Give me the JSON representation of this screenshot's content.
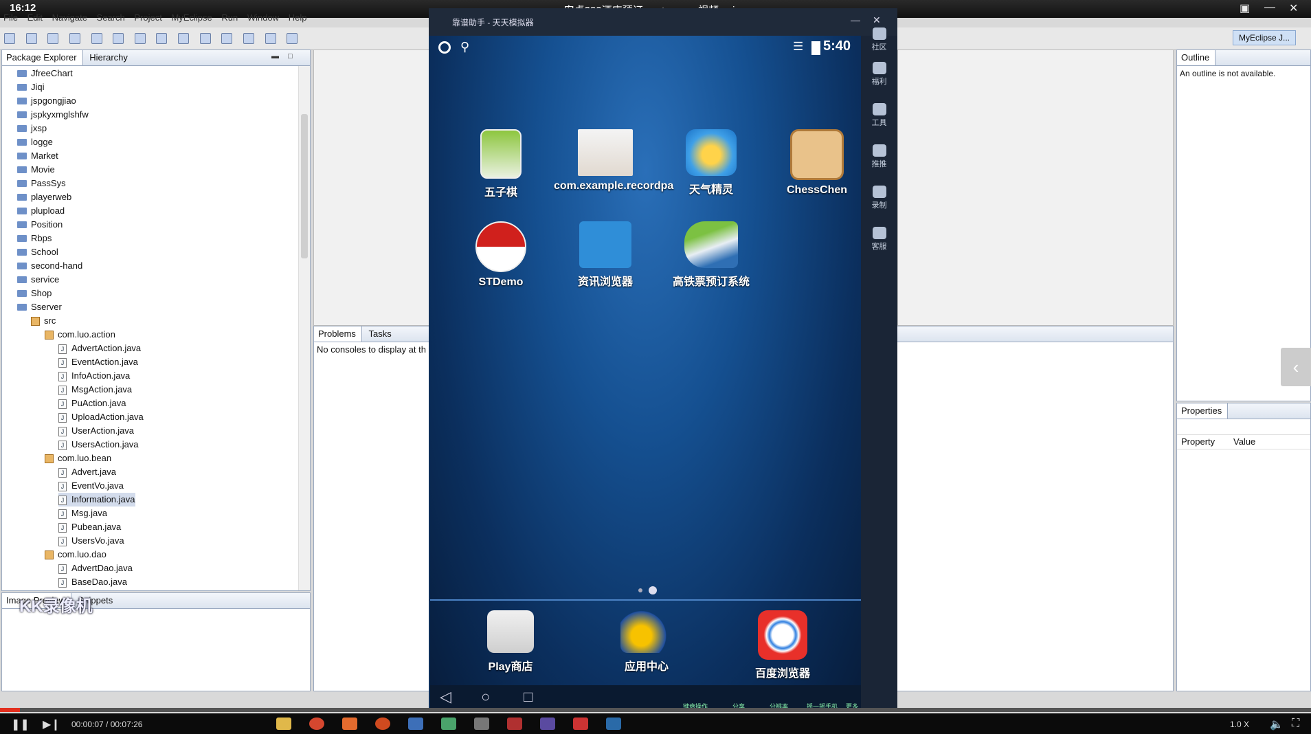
{
  "player": {
    "clock": "16:12",
    "title": "安卓382酒店预订app+server-视频.avi",
    "time_display": "00:00:07 / 00:07:26",
    "speed": "1.0 X",
    "progress": 0.015
  },
  "menu": [
    "File",
    "Edit",
    "Navigate",
    "Search",
    "Project",
    "MyEclipse",
    "Run",
    "Window",
    "Help"
  ],
  "perspective": "MyEclipse J...",
  "package_explorer": {
    "tabs": [
      "Package Explorer",
      "Hierarchy"
    ],
    "projects": [
      "JfreeChart",
      "Jiqi",
      "jspgongjiao",
      "jspkyxmglshfw",
      "jxsp",
      "logge",
      "Market",
      "Movie",
      "PassSys",
      "playerweb",
      "plupload",
      "Position",
      "Rbps",
      "School",
      "second-hand",
      "service",
      "Shop",
      "Sserver"
    ],
    "src": "src",
    "packages": [
      {
        "name": "com.luo.action",
        "files": [
          "AdvertAction.java",
          "EventAction.java",
          "InfoAction.java",
          "MsgAction.java",
          "PuAction.java",
          "UploadAction.java",
          "UserAction.java",
          "UsersAction.java"
        ]
      },
      {
        "name": "com.luo.bean",
        "files": [
          "Advert.java",
          "EventVo.java",
          "Information.java",
          "Msg.java",
          "Pubean.java",
          "UsersVo.java"
        ]
      },
      {
        "name": "com.luo.dao",
        "files": [
          "AdvertDao.java",
          "BaseDao.java"
        ]
      }
    ],
    "selected_file": "Information.java"
  },
  "bottom_left": {
    "tabs": [
      "Image Preview",
      "Snippets"
    ]
  },
  "console": {
    "tabs": [
      "Problems",
      "Tasks"
    ],
    "message": "No consoles to display at th"
  },
  "outline": {
    "tab": "Outline",
    "message": "An outline is not available."
  },
  "properties": {
    "tab": "Properties",
    "col_property": "Property",
    "col_value": "Value"
  },
  "watermark": "KK录像机",
  "emulator": {
    "window_title": "靠谱助手 - 天天模拟器",
    "status_time": "5:40",
    "apps_row1": [
      "五子棋",
      "com.example.recordpa",
      "天气精灵",
      "ChessChen"
    ],
    "apps_row2": [
      "STDemo",
      "资讯浏览器",
      "高铁票预订系统"
    ],
    "dock": [
      "Play商店",
      "应用中心",
      "百度浏览器"
    ],
    "side": [
      "社区",
      "福利",
      "工具",
      "推推",
      "录制",
      "客服"
    ],
    "bottom_tools": [
      "键盘操作",
      "分享",
      "分辨率",
      "摇一摇手机",
      "更多"
    ]
  }
}
